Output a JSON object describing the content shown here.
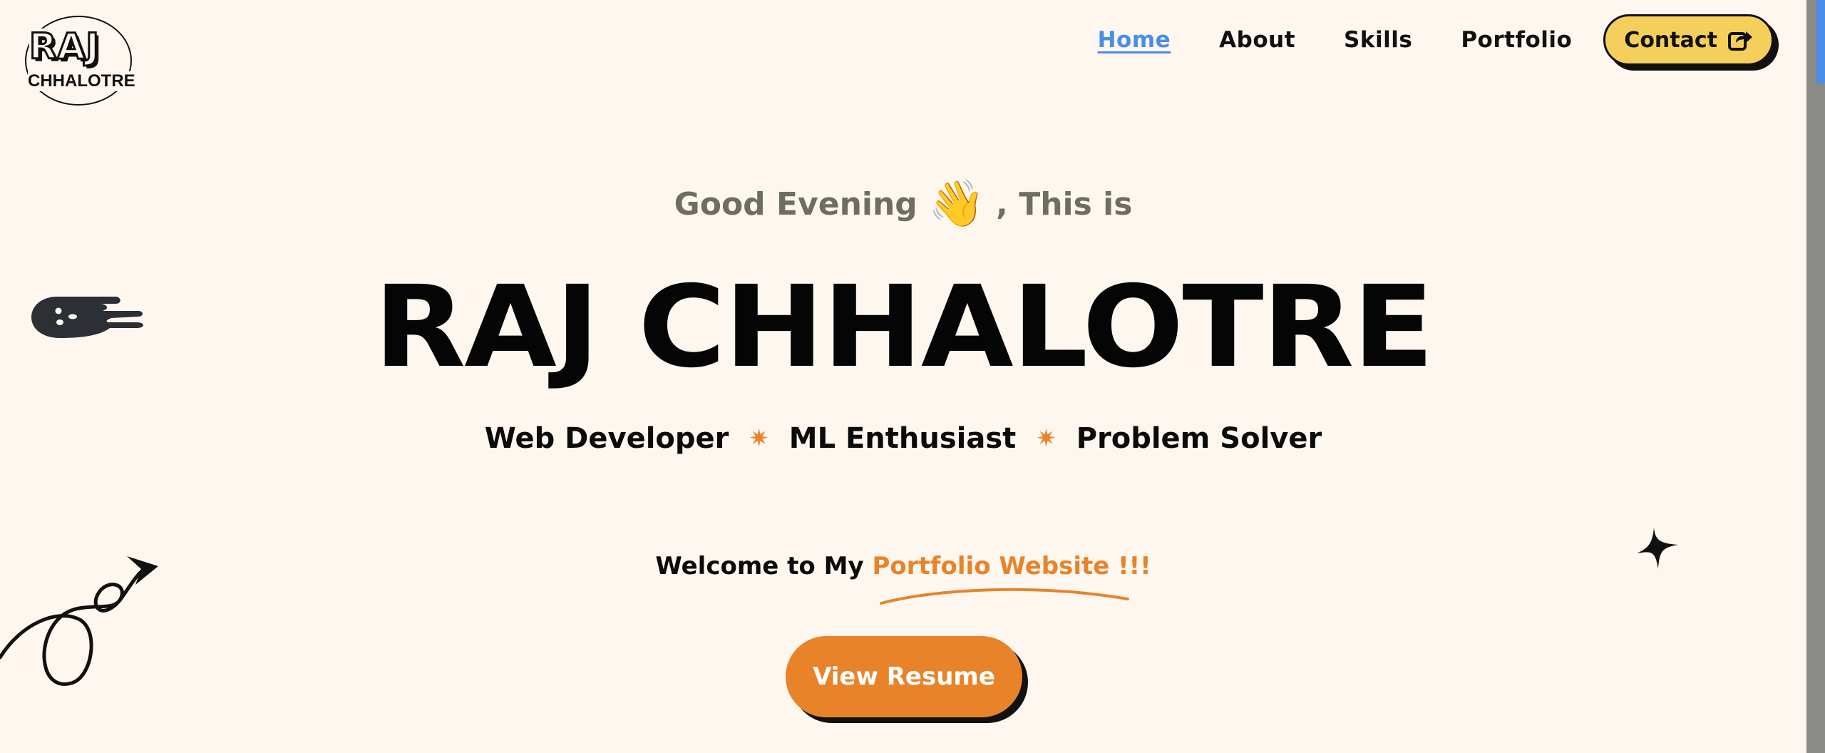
{
  "logo": {
    "top": "RAJ",
    "bottom": "CHHALOTRE"
  },
  "nav": {
    "items": [
      {
        "label": "Home",
        "active": true
      },
      {
        "label": "About",
        "active": false
      },
      {
        "label": "Skills",
        "active": false
      },
      {
        "label": "Portfolio",
        "active": false
      }
    ],
    "contact_label": "Contact",
    "contact_icon": "share-icon"
  },
  "hero": {
    "greeting_prefix": "Good Evening",
    "greeting_emoji": "👋",
    "greeting_suffix": ", This is",
    "name": "RAJ CHHALOTRE",
    "roles": [
      "Web Developer",
      "ML Enthusiast",
      "Problem Solver"
    ],
    "welcome_prefix": "Welcome to My ",
    "welcome_highlight": "Portfolio Website !!!",
    "resume_label": "View Resume"
  },
  "colors": {
    "background": "#fdf7ef",
    "accent_orange": "#e8832a",
    "contact_yellow": "#f4cf5c",
    "active_link_blue": "#4a8ee8",
    "greeting_gray": "#6e6e60"
  }
}
